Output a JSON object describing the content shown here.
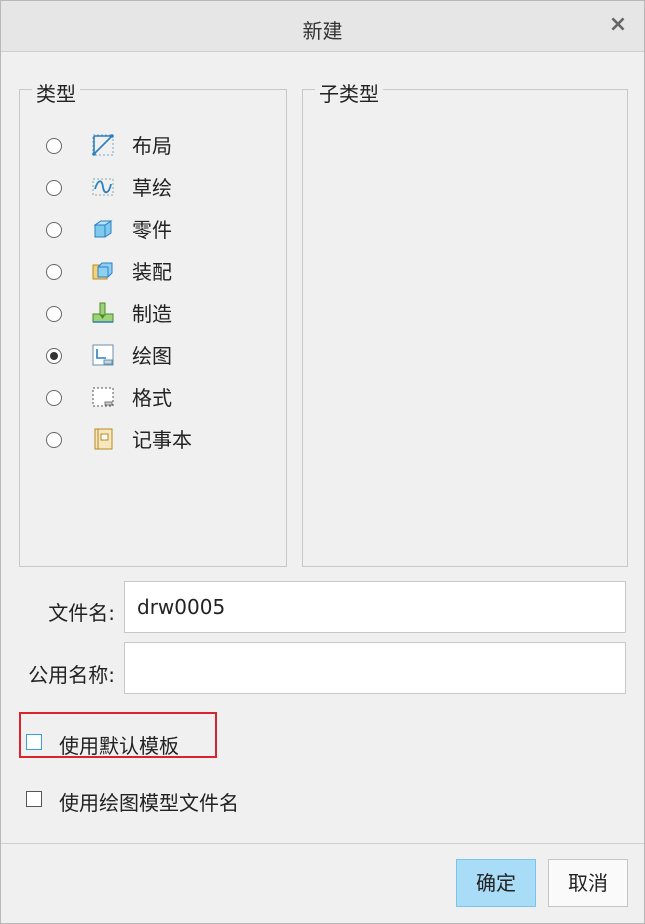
{
  "dialog": {
    "title": "新建",
    "close_symbol": "×",
    "type_group": {
      "legend": "类型",
      "items": [
        {
          "label": "布局",
          "icon": "layout-icon",
          "checked": false
        },
        {
          "label": "草绘",
          "icon": "sketch-icon",
          "checked": false
        },
        {
          "label": "零件",
          "icon": "part-icon",
          "checked": false
        },
        {
          "label": "装配",
          "icon": "assembly-icon",
          "checked": false
        },
        {
          "label": "制造",
          "icon": "manufacturing-icon",
          "checked": false
        },
        {
          "label": "绘图",
          "icon": "drawing-icon",
          "checked": true
        },
        {
          "label": "格式",
          "icon": "format-icon",
          "checked": false
        },
        {
          "label": "记事本",
          "icon": "notebook-icon",
          "checked": false
        }
      ]
    },
    "subtype_group": {
      "legend": "子类型"
    },
    "filename": {
      "label": "文件名:",
      "value": "drw0005"
    },
    "common_name": {
      "label": "公用名称:",
      "value": ""
    },
    "use_default_template": {
      "label": "使用默认模板",
      "checked": false
    },
    "use_drawing_model_name": {
      "label": "使用绘图模型文件名",
      "checked": false
    },
    "buttons": {
      "ok": "确定",
      "cancel": "取消"
    },
    "colors": {
      "ok_button": "#a9dcf7",
      "highlight": "#d9232e",
      "icon_blue": "#3aa0d8"
    }
  }
}
